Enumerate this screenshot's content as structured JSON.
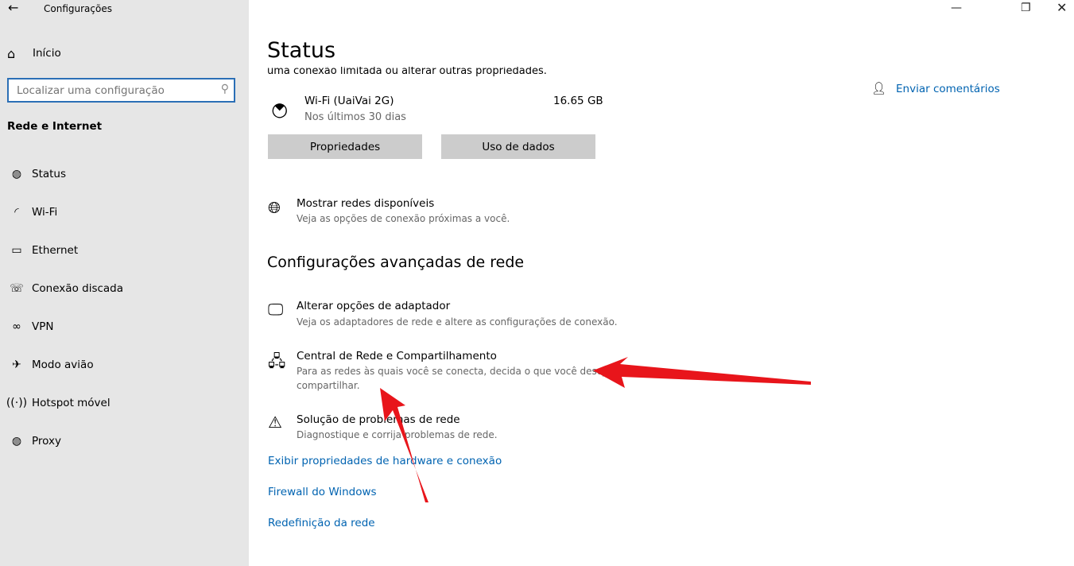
{
  "window": {
    "title": "Configurações",
    "back_icon": "arrow-left-icon",
    "controls": [
      "minimize-icon",
      "restore-icon",
      "close-icon"
    ]
  },
  "sidebar": {
    "home": "Início",
    "search_placeholder": "Localizar uma configuração",
    "section": "Rede e Internet",
    "items": [
      {
        "label": "Status",
        "icon": "globe-status-icon"
      },
      {
        "label": "Wi-Fi",
        "icon": "wifi-icon"
      },
      {
        "label": "Ethernet",
        "icon": "ethernet-icon"
      },
      {
        "label": "Conexão discada",
        "icon": "dialup-icon"
      },
      {
        "label": "VPN",
        "icon": "vpn-icon"
      },
      {
        "label": "Modo avião",
        "icon": "airplane-icon"
      },
      {
        "label": "Hotspot móvel",
        "icon": "hotspot-icon"
      },
      {
        "label": "Proxy",
        "icon": "globe-icon"
      }
    ]
  },
  "main": {
    "title": "Status",
    "clipped_text": "uma conexão limitada ou alterar outras propriedades.",
    "network": {
      "name": "Wi-Fi (UaiVai 2G)",
      "period": "Nos últimos 30 dias",
      "usage": "16.65 GB"
    },
    "buttons": {
      "properties": "Propriedades",
      "data_usage": "Uso de dados"
    },
    "show_networks": {
      "title": "Mostrar redes disponíveis",
      "desc": "Veja as opções de conexão próximas a você."
    },
    "advanced_heading": "Configurações avançadas de rede",
    "adapter": {
      "title": "Alterar opções de adaptador",
      "desc": "Veja os adaptadores de rede e altere as configurações de conexão."
    },
    "sharing_center": {
      "title": "Central de Rede e Compartilhamento",
      "desc1": "Para as redes às quais você se conecta, decida o que você deseja",
      "desc2": "compartilhar."
    },
    "troubleshoot": {
      "title": "Solução de problemas de rede",
      "desc": "Diagnostique e corrija problemas de rede."
    },
    "links": [
      "Exibir propriedades de hardware e conexão",
      "Firewall do Windows",
      "Redefinição da rede"
    ]
  },
  "feedback": "Enviar comentários",
  "annotation_color": "#e8151b"
}
